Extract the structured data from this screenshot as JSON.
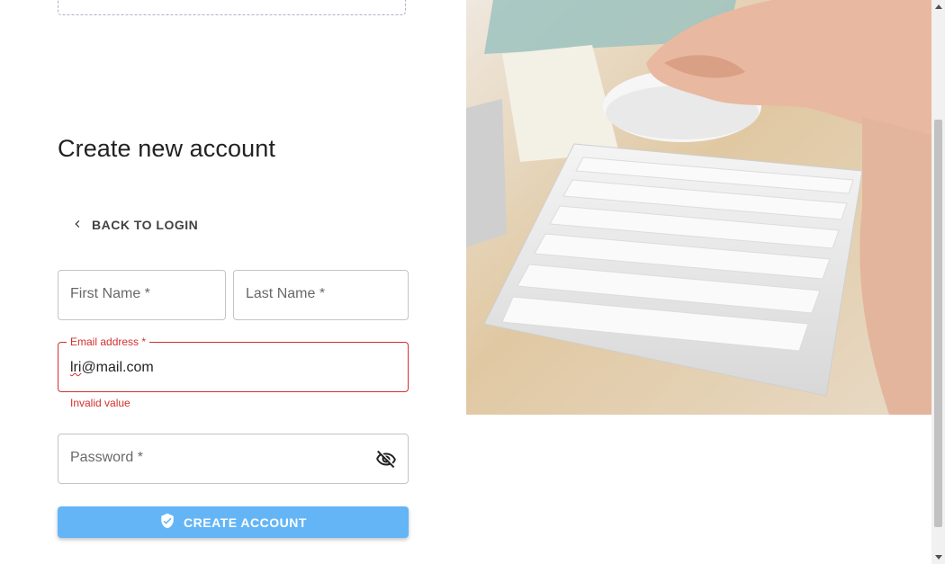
{
  "page": {
    "title": "Create new account"
  },
  "nav": {
    "back_label": "BACK TO LOGIN"
  },
  "form": {
    "first_name_label": "First Name *",
    "last_name_label": "Last Name *",
    "email_label": "Email address *",
    "email_value_misspelled": "lri",
    "email_value_rest": "@mail.com",
    "email_error": "Invalid value",
    "password_label": "Password *",
    "submit_label": "CREATE ACCOUNT"
  },
  "icons": {
    "back": "chevron-left-icon",
    "password_toggle": "eye-off-icon",
    "submit": "verified-shield-icon"
  },
  "colors": {
    "primary": "#64b5f6",
    "error": "#d32f2f",
    "border": "#c4c4c4"
  }
}
